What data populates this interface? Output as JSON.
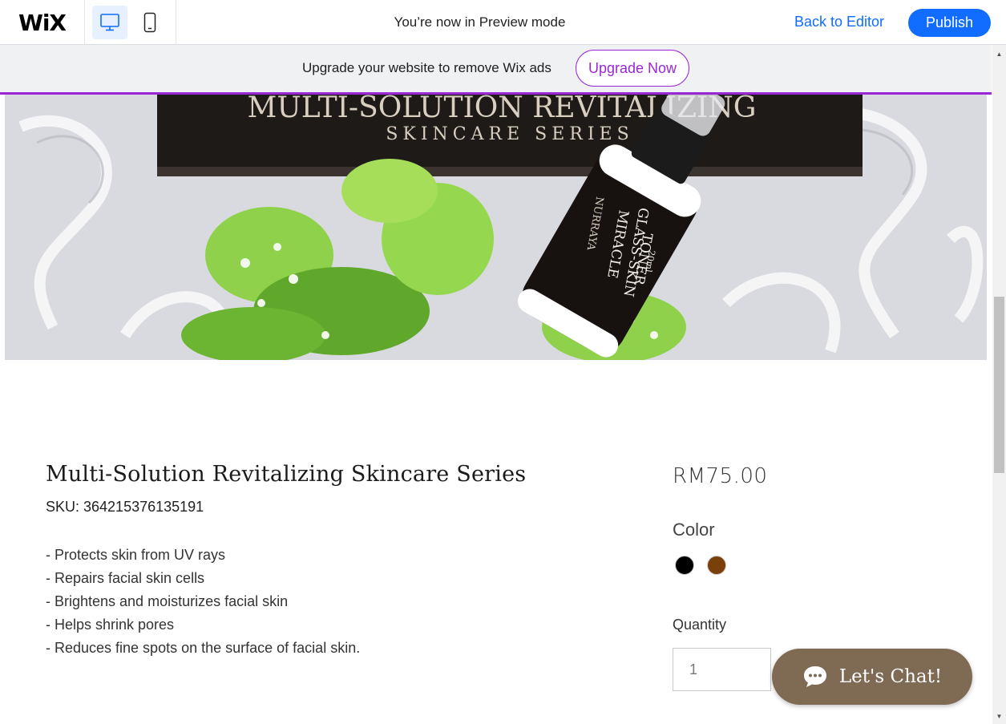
{
  "topbar": {
    "logo": "WiX",
    "devices": [
      {
        "name": "desktop",
        "icon": "desktop-icon",
        "active": true
      },
      {
        "name": "mobile",
        "icon": "mobile-icon",
        "active": false
      }
    ],
    "preview_text": "You’re now in Preview mode",
    "back_label": "Back to Editor",
    "publish_label": "Publish"
  },
  "banner": {
    "text": "Upgrade your website to remove Wix ads",
    "button_label": "Upgrade Now"
  },
  "hero": {
    "box_title": "MULTI-SOLUTION REVITALIZING",
    "box_subtitle": "SKINCARE SERIES",
    "bottle_brand": "NURRAYA",
    "bottle_line1": "MIRACLE",
    "bottle_line2": "GLASS-SKIN",
    "bottle_line3": "TONER",
    "bottle_volume": "20ml"
  },
  "product": {
    "title": "Multi-Solution Revitalizing Skincare Series",
    "sku": "SKU: 364215376135191",
    "features": [
      "- Protects skin from UV rays",
      "- Repairs facial skin cells",
      "- Brightens and moisturizes facial skin",
      "- Helps shrink pores",
      "- Reduces fine spots on the surface of facial skin."
    ],
    "price": "RM75.00",
    "color_label": "Color",
    "colors": [
      "#000000",
      "#7b3f0a"
    ],
    "quantity_label": "Quantity",
    "quantity_value": "1"
  },
  "chat": {
    "label": "Let's Chat!",
    "icon": "chat-bubble-icon"
  },
  "colors": {
    "accent_blue": "#116dff",
    "upgrade_purple": "#9a27d5",
    "chat_brown": "#7f6a54"
  }
}
